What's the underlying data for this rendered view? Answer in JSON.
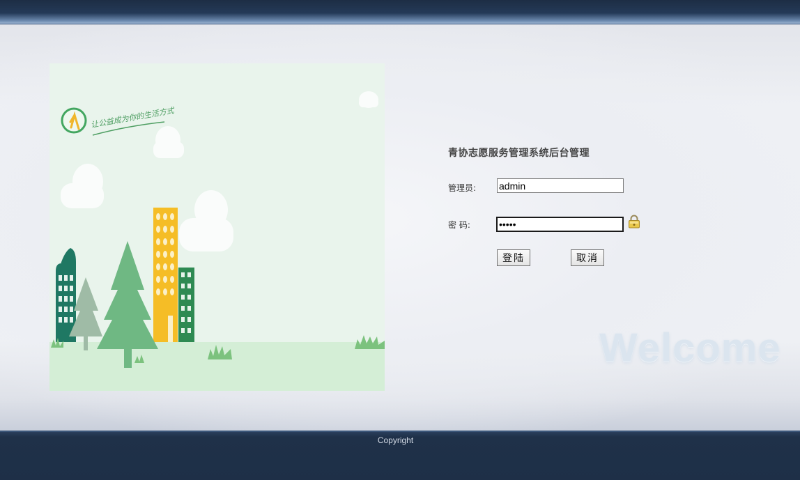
{
  "header": {},
  "illustration": {
    "slogan": "让公益成为你的生活方式",
    "logo_glyph": "人",
    "colors": {
      "sky": "#e9f4ec",
      "ground": "#d4eed6",
      "tree_dark": "#6fb883",
      "tree_grey": "#9fbba6",
      "building_teal": "#1f7863",
      "building_yellow": "#f5bd26",
      "building_green": "#2e8a52",
      "cloud": "#fafcfb",
      "grass": "#7cc27e"
    }
  },
  "login": {
    "title": "青协志愿服务管理系统后台管理",
    "username_label": "管理员:",
    "username_value": "admin",
    "password_label": "密 码:",
    "password_value": "•••••",
    "login_button": "登陆",
    "cancel_button": "取消"
  },
  "decor": {
    "welcome_text": "Welcome"
  },
  "footer": {
    "copyright": "Copyright"
  }
}
